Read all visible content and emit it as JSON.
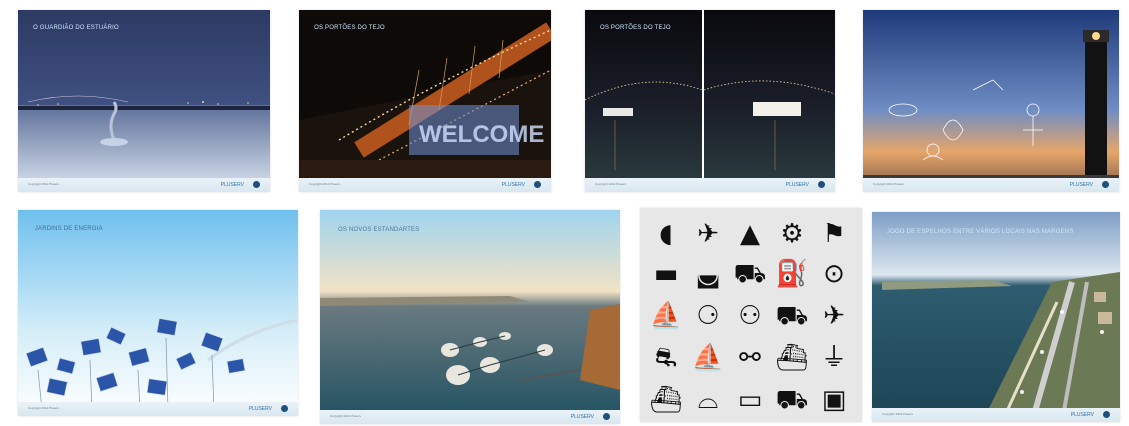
{
  "slides": [
    {
      "title": "O GUARDIÃO DO ESTUÁRIO",
      "copyright": "Copyright 2012 Pluserv"
    },
    {
      "title": "OS PORTÕES DO TEJO",
      "copyright": "Copyright 2012 Pluserv"
    },
    {
      "title": "OS PORTÕES DO TEJO",
      "copyright": "Copyright 2012 Pluserv"
    },
    {
      "title": "",
      "copyright": "Copyright 2012 Pluserv"
    },
    {
      "title": "JARDINS DE ENERGIA",
      "copyright": "Copyright 2012 Pluserv"
    },
    {
      "title": "OS NOVOS ESTANDARTES",
      "copyright": "Copyright 2012 Pluserv"
    },
    {
      "title": "JOGO DE ESPELHOS ENTRE VÁRIOS LOCAIS NAS MARGENS",
      "copyright": "Copyright 2012 Pluserv"
    }
  ],
  "footer_logo": "PLUSERV",
  "overlay_word": "WELCOME",
  "transport_icons": [
    "airship-icon",
    "airplane-icon",
    "rocket-icon",
    "motorcycle-icon",
    "helicopter-icon",
    "speedboat-icon",
    "trailer-icon",
    "car-icon",
    "watering-can-icon",
    "unicycle-icon",
    "sailboat-icon",
    "penny-farthing-icon",
    "bicycle-icon",
    "truck-icon",
    "plane-side-icon",
    "tractor-icon",
    "boat-icon",
    "scooter-icon",
    "locomotive-icon",
    "cable-car-icon",
    "ship-icon",
    "canoe-icon",
    "bus-icon",
    "jeep-icon",
    "van-icon"
  ]
}
